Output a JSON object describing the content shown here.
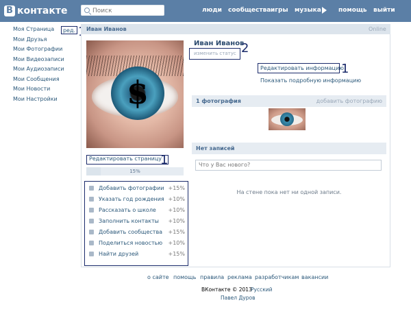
{
  "colors": {
    "header": "#5b7fa6",
    "link": "#2b587a",
    "annotation": "#1a2a6a",
    "panel_bar": "#dce4ec"
  },
  "header": {
    "logo_letter": "В",
    "logo_text": "контакте",
    "search_placeholder": "Поиск",
    "nav": [
      "люди",
      "сообщества",
      "игры",
      "музыка",
      "помощь",
      "выйти"
    ]
  },
  "sidebar": {
    "items": [
      "Моя Страница",
      "Мои Друзья",
      "Мои Фотографии",
      "Мои Видеозаписи",
      "Мои Аудиозаписи",
      "Мои Сообщения",
      "Мои Новости",
      "Мои Настройки"
    ],
    "edit_label": "ред.",
    "edit_marker": "1"
  },
  "profile": {
    "bar_name": "Иван Иванов",
    "online": "Online",
    "name": "Иван Иванов",
    "status_link": "изменить статус",
    "status_marker": "2",
    "edit_info": "Редактировать информацию",
    "edit_info_marker": "1",
    "more_info": "Показать подробную информацию",
    "edit_page": "Редактировать страницу",
    "edit_page_marker": "1",
    "completion_percent": 15,
    "completion_label": "15%"
  },
  "tasks": [
    {
      "label": "Добавить фотографии",
      "percent": "+15%",
      "icon": "photo-icon"
    },
    {
      "label": "Указать год рождения",
      "percent": "+10%",
      "icon": "gift-icon"
    },
    {
      "label": "Рассказать о школе",
      "percent": "+10%",
      "icon": "school-icon"
    },
    {
      "label": "Заполнить контакты",
      "percent": "+10%",
      "icon": "phone-icon"
    },
    {
      "label": "Добавить сообщества",
      "percent": "+15%",
      "icon": "star-icon"
    },
    {
      "label": "Поделиться новостью",
      "percent": "+10%",
      "icon": "megaphone-icon"
    },
    {
      "label": "Найти друзей",
      "percent": "+15%",
      "icon": "friends-icon"
    }
  ],
  "photos": {
    "title": "1 фотография",
    "add_link": "добавить фотографию"
  },
  "wall": {
    "title": "Нет записей",
    "input_placeholder": "Что у Вас нового?",
    "empty_text": "На стене пока нет ни одной записи."
  },
  "footer": {
    "links": [
      "о сайте",
      "помощь",
      "правила",
      "реклама",
      "разработчикам",
      "вакансии"
    ],
    "copyright": "ВКонтакте © 2013",
    "language": "Русский",
    "author": "Павел Дуров"
  }
}
